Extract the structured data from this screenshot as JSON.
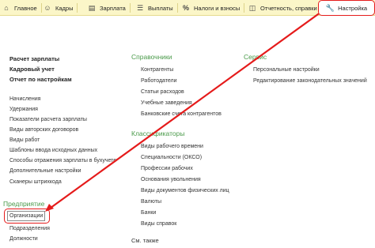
{
  "topbar": {
    "tabs": [
      {
        "label": "Главное",
        "icon": "home-icon"
      },
      {
        "label": "Кадры",
        "icon": "people-icon"
      },
      {
        "label": "Зарплата",
        "icon": "document-icon"
      },
      {
        "label": "Выплаты",
        "icon": "payments-icon"
      },
      {
        "label": "Налоги и взносы",
        "icon": "percent-icon"
      },
      {
        "label": "Отчетность, справки",
        "icon": "reports-icon"
      }
    ],
    "settings": {
      "label": "Настройка",
      "icon": "wrench-icon"
    }
  },
  "column1": {
    "bold_links": [
      "Расчет зарплаты",
      "Кадровый учет",
      "Отчет по настройкам"
    ],
    "links": [
      "Начисления",
      "Удержания",
      "Показатели расчета зарплаты",
      "Виды авторских договоров",
      "Виды работ",
      "Шаблоны ввода исходных данных",
      "Способы отражения зарплаты в бухучете",
      "Дополнительные настройки",
      "Сканеры штрихкода"
    ],
    "section_title": "Предприятие",
    "section_links": [
      "Организации",
      "Подразделения",
      "Должности"
    ]
  },
  "column2": {
    "catalogs_title": "Справочники",
    "catalogs": [
      "Контрагенты",
      "Работодатели",
      "Статьи расходов",
      "Учебные заведения",
      "Банковские счета контрагентов"
    ],
    "classifiers_title": "Классификаторы",
    "classifiers": [
      "Виды рабочего времени",
      "Специальности (ОКСО)",
      "Профессии рабочих",
      "Основания увольнения",
      "Виды документов физических лиц",
      "Валюты",
      "Банки",
      "Виды справок"
    ],
    "see_also": "См. также"
  },
  "column3": {
    "title": "Сервис",
    "links": [
      "Персональные настройки",
      "Редактирование законодательных значений"
    ]
  },
  "colors": {
    "accent_red": "#e51b1b",
    "section_green": "#4a9a4a",
    "topbar_yellow": "#fbf6c8"
  }
}
